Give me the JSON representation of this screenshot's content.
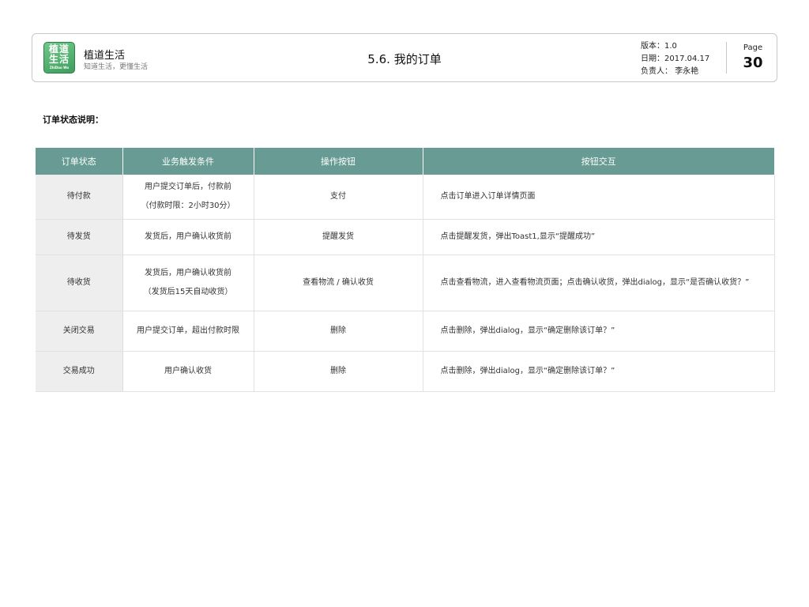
{
  "header": {
    "logo_chars": "植道生活",
    "logo_sub": "ZhiDao Wo",
    "brand_name": "植道生活",
    "brand_tagline": "知道生活，更懂生活",
    "doc_title": "5.6. 我的订单",
    "meta": {
      "version": "版本：1.0",
      "date": "日期：2017.04.17",
      "owner": "负责人：  李永艳"
    },
    "page_label": "Page",
    "page_number": "30"
  },
  "section_title": "订单状态说明：",
  "table": {
    "headers": [
      "订单状态",
      "业务触发条件",
      "操作按钮",
      "按钮交互"
    ],
    "rows": [
      {
        "status": "待付款",
        "trigger": [
          "用户提交订单后，付款前",
          "（付款时限：2小时30分）"
        ],
        "button": "支付",
        "interaction": "点击订单进入订单详情页面"
      },
      {
        "status": "待发货",
        "trigger": [
          "发货后，用户确认收货前"
        ],
        "button": "提醒发货",
        "interaction": "点击提醒发货，弹出Toast1,显示“提醒成功”"
      },
      {
        "status": "待收货",
        "trigger": [
          "发货后，用户确认收货前",
          "（发货后15天自动收货）"
        ],
        "button": "查看物流 / 确认收货",
        "interaction": "点击查看物流，进入查看物流页面；点击确认收货，弹出dialog，显示“是否确认收货？”"
      },
      {
        "status": "关闭交易",
        "trigger": [
          "用户提交订单，超出付款时限"
        ],
        "button": "删除",
        "interaction": "点击删除，弹出dialog，显示“确定删除该订单？”"
      },
      {
        "status": "交易成功",
        "trigger": [
          "用户确认收货"
        ],
        "button": "删除",
        "interaction": "点击删除，弹出dialog，显示“确定删除该订单？”"
      }
    ]
  },
  "colors": {
    "table_header_bg": "#679b93",
    "status_cell_bg": "#eeeeee",
    "logo_green": "#4caf6a"
  }
}
